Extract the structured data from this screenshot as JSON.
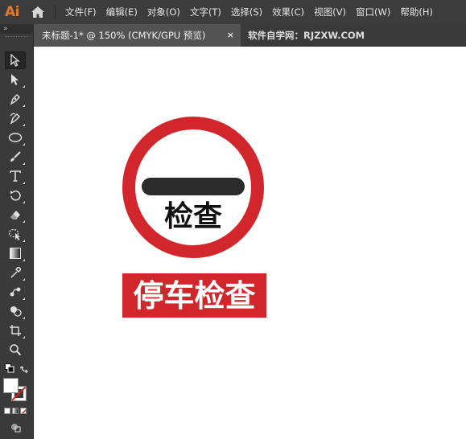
{
  "app": {
    "logo_text": "Ai",
    "brand_color": "#e07a2c"
  },
  "menu": {
    "items": [
      {
        "label": "文件(F)"
      },
      {
        "label": "编辑(E)"
      },
      {
        "label": "对象(O)"
      },
      {
        "label": "文字(T)"
      },
      {
        "label": "选择(S)"
      },
      {
        "label": "效果(C)"
      },
      {
        "label": "视图(V)"
      },
      {
        "label": "窗口(W)"
      },
      {
        "label": "帮助(H)"
      }
    ]
  },
  "toolbar": {
    "collapse_label": "»",
    "tools": [
      {
        "name": "selection-tool",
        "icon": "selection-arrow-icon",
        "active": true
      },
      {
        "name": "direct-selection-tool",
        "icon": "direct-selection-arrow-icon"
      },
      {
        "name": "pen-tool",
        "icon": "pen-icon"
      },
      {
        "name": "curvature-tool",
        "icon": "curvature-pen-icon"
      },
      {
        "name": "ellipse-tool",
        "icon": "ellipse-icon"
      },
      {
        "name": "paintbrush-tool",
        "icon": "paintbrush-icon"
      },
      {
        "name": "type-tool",
        "icon": "type-icon"
      },
      {
        "name": "rotate-tool",
        "icon": "rotate-icon"
      },
      {
        "name": "eraser-tool",
        "icon": "eraser-icon"
      },
      {
        "name": "puppet-warp-tool",
        "icon": "puppet-warp-icon"
      },
      {
        "name": "gradient-tool",
        "icon": "gradient-icon"
      },
      {
        "name": "eyedropper-tool",
        "icon": "eyedropper-icon"
      },
      {
        "name": "blend-tool",
        "icon": "blend-icon"
      },
      {
        "name": "shape-builder-tool",
        "icon": "shape-builder-icon"
      },
      {
        "name": "artboard-tool",
        "icon": "artboard-icon"
      },
      {
        "name": "zoom-tool",
        "icon": "zoom-icon"
      }
    ]
  },
  "tabs": {
    "active": {
      "label": "未标题-1* @ 150% (CMYK/GPU 预览)",
      "close": "×"
    },
    "inactive": {
      "label": "软件自学网：RJZXW.COM"
    }
  },
  "artwork": {
    "sign_label": "检查",
    "banner_label": "停车检查",
    "colors": {
      "ring": "#d1262b",
      "bar": "#2b2b2b",
      "banner": "#d1262b",
      "banner_text": "#ffffff",
      "sign_text": "#111111"
    }
  }
}
